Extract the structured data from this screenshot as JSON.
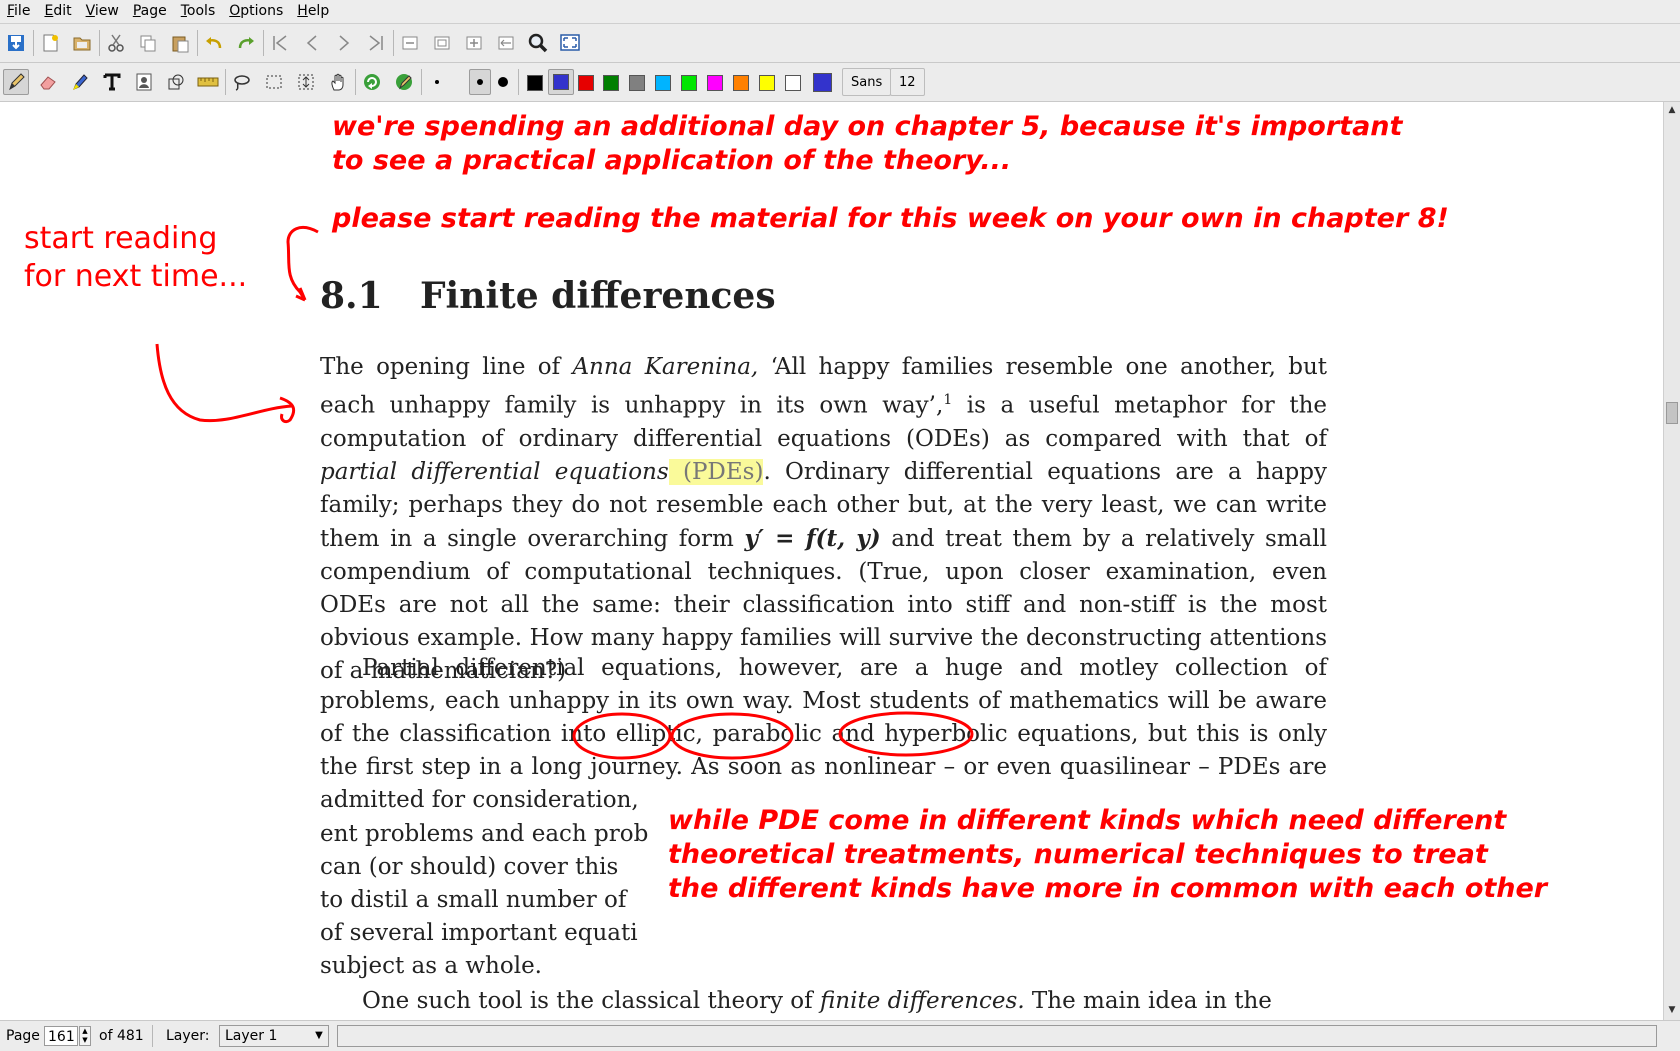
{
  "menubar": {
    "items": [
      "File",
      "Edit",
      "View",
      "Page",
      "Tools",
      "Options",
      "Help"
    ]
  },
  "toolbar2": {
    "font_name": "Sans",
    "font_size": "12"
  },
  "pen_colors": [
    "#000000",
    "#3333cc",
    "#e60000",
    "#007f00",
    "#808080",
    "#00b4ff",
    "#00e600",
    "#ff00ff",
    "#ff8000",
    "#ffff00",
    "#ffffff",
    "#3333cc"
  ],
  "document": {
    "section_number": "8.1",
    "section_title": "Finite differences",
    "paragraphs": {
      "p1_a": "The opening line of ",
      "p1_b": "Anna Karenina,",
      "p1_c": " ‘All happy families resemble one another, but each unhappy family is unhappy in its own way’,",
      "p1_fn": "1",
      "p1_d": " is a useful metaphor for the computation of ordinary differential equations (ODEs) as compared with that of ",
      "p1_e": "partial differential equations",
      "p1_f": " (PDEs)",
      "p1_g": ". Ordinary differential equations are a happy family; perhaps they do not resemble each other but, at the very least, we can write them in a single overarching form ",
      "p1_formula": "y′ = f(t, y)",
      "p1_h": " and treat them by a relatively small compendium of computational techniques. (True, upon closer examination, even ODEs are not all the same: their classification into stiff and non-stiff is the most obvious example. How many happy families will survive the deconstructing attentions of a mathematician?)",
      "p2_a": "Partial differential equations, however, are a huge and motley collection of problems, each unhappy in its own way. Most students of mathematics will be aware of the classification into ",
      "p2_elliptic": "elliptic",
      "p2_b": ", ",
      "p2_parabolic": "parabolic",
      "p2_c": " and ",
      "p2_hyperbolic": "hyperbolic",
      "p2_d": " equations, but this is only the first step in a long journey. As soon as nonlinear – or even quasilinear – PDEs are admitted for consideration,",
      "p2_l6": "ent problems and each prob",
      "p2_l7": "can (or should) cover this",
      "p2_l8": "to distil a small number of",
      "p2_l9": "of several important equati",
      "p2_l10": "subject as a whole.",
      "p3_a": "One such tool is the classical theory of ",
      "p3_b": "finite differences.",
      "p3_c": " The main idea in the"
    }
  },
  "annotations": {
    "note_top": "we're spending an additional day on chapter 5, because it's important\nto see a practical application of the theory...",
    "note_reading": "please start reading the material for this week on your own in chapter 8!",
    "note_left": "start reading\nfor next time...",
    "note_bottom": "while PDE come in different kinds which need different\ntheoretical treatments, numerical techniques to treat\nthe different kinds have more in common with each other"
  },
  "statusbar": {
    "page_label": "Page",
    "page_value": "161",
    "page_total": "of 481",
    "layer_label": "Layer:",
    "layer_value": "Layer 1"
  },
  "colors": {
    "ink": "#ff0000",
    "highlight": "#fafa9a",
    "toolbar_bg": "#ececec"
  }
}
